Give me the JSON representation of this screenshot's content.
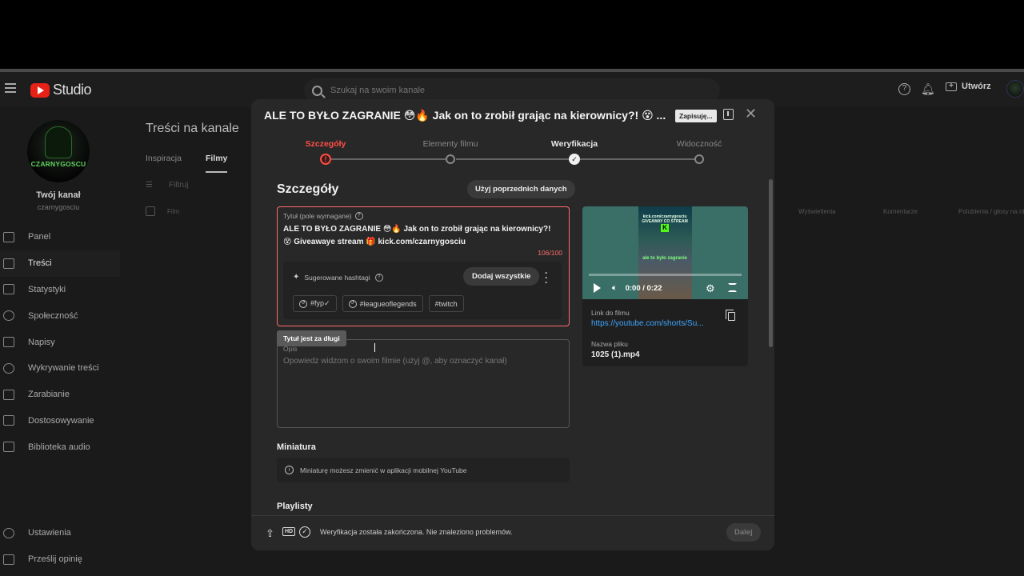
{
  "app": {
    "logo_text": "Studio",
    "search_placeholder": "Szukaj na swoim kanale",
    "create_label": "Utwórz"
  },
  "channel": {
    "avatar_text": "CZARNYGOSCU",
    "title": "Twój kanał",
    "handle": "czarnygosciu"
  },
  "sidebar": {
    "items": [
      {
        "label": "Panel",
        "icon": "dashboard-icon"
      },
      {
        "label": "Treści",
        "icon": "content-icon"
      },
      {
        "label": "Statystyki",
        "icon": "analytics-icon"
      },
      {
        "label": "Społeczność",
        "icon": "community-icon"
      },
      {
        "label": "Napisy",
        "icon": "subtitles-icon"
      },
      {
        "label": "Wykrywanie treści",
        "icon": "copyright-icon"
      },
      {
        "label": "Zarabianie",
        "icon": "monetization-icon"
      },
      {
        "label": "Dostosowywanie",
        "icon": "customization-icon"
      },
      {
        "label": "Biblioteka audio",
        "icon": "audio-library-icon"
      }
    ],
    "bottom": [
      {
        "label": "Ustawienia",
        "icon": "gear-icon"
      },
      {
        "label": "Prześlij opinię",
        "icon": "feedback-icon"
      }
    ]
  },
  "content": {
    "title": "Treści na kanale",
    "tabs": [
      "Inspiracja",
      "Filmy"
    ],
    "filter_label": "Filtruj",
    "columns": {
      "film": "Film",
      "views": "Wyświetlenia",
      "comments": "Komentarze",
      "likes": "Polubienia / głosy na nie"
    }
  },
  "modal": {
    "title": "ALE TO BYŁO ZAGRANIE 😳🔥 Jak on to zrobił grając na kierownicy?! 😵 ...",
    "saving_badge": "Zapisuję...",
    "steps": [
      "Szczegóły",
      "Elementy filmu",
      "Weryfikacja",
      "Widoczność"
    ],
    "section_title": "Szczegóły",
    "reuse_button": "Użyj poprzednich danych",
    "title_field": {
      "label": "Tytuł (pole wymagane)",
      "value": "ALE TO BYŁO ZAGRANIE 😳🔥 Jak on to zrobił grając na kierownicy?! 😵 Giveawaye stream 🎁 kick.com/czarnygosciu",
      "counter": "106/100",
      "error_tooltip": "Tytuł jest za długi"
    },
    "hashtags": {
      "label": "Sugerowane hashtagi",
      "add_all": "Dodaj wszystkie",
      "chips": [
        "#fyp✓",
        "#leagueoflegends",
        "#twitch"
      ]
    },
    "description": {
      "label": "Opis",
      "placeholder": "Opowiedz widzom o swoim filmie (użyj @, aby oznaczyć kanał)"
    },
    "thumbnail": {
      "title": "Miniatura",
      "info": "Miniaturę możesz zmienić w aplikacji mobilnej YouTube"
    },
    "playlists_title": "Playlisty",
    "video": {
      "overlay_top": "kick.com/czarnygosciu GIVEAWAY CO STREAM",
      "overlay_logo": "K",
      "overlay_caption": "ale to było zagranie",
      "time": "0:00 / 0:22",
      "progress": 0.0,
      "link_label": "Link do filmu",
      "link_url": "https://youtube.com/shorts/Su...",
      "file_label": "Nazwa pliku",
      "file_name": "1025 (1).mp4"
    },
    "footer": {
      "status": "Weryfikacja została zakończona. Nie znaleziono problemów.",
      "next_button": "Dalej"
    }
  },
  "colors": {
    "error": "#ff4e45",
    "link": "#3ea6ff",
    "brand": "#e62117"
  }
}
